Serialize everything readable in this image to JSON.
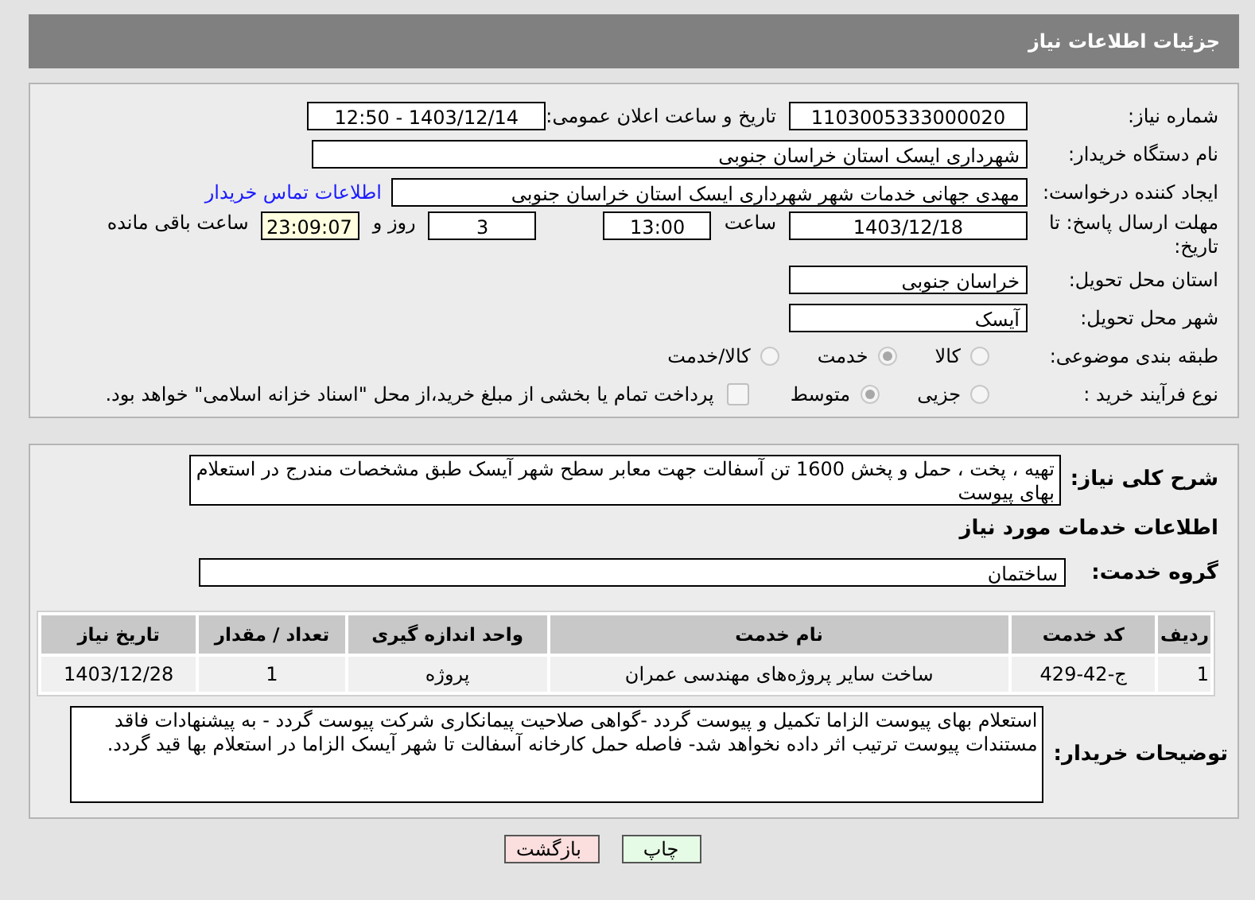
{
  "header": {
    "title": "جزئیات اطلاعات نیاز"
  },
  "need_number": {
    "label": "شماره نیاز:",
    "value": "1103005333000020"
  },
  "announce": {
    "label": "تاریخ و ساعت اعلان عمومی:",
    "value": "1403/12/14 - 12:50"
  },
  "buyer_org": {
    "label": "نام دستگاه خریدار:",
    "value": "شهرداری ایسک استان خراسان جنوبی"
  },
  "requester": {
    "label": "ایجاد کننده درخواست:",
    "value": "مهدی جهانی خدمات شهر شهرداری ایسک استان خراسان جنوبی",
    "link": "اطلاعات تماس خریدار"
  },
  "deadline": {
    "label": "مهلت ارسال پاسخ: تا تاریخ:",
    "date": "1403/12/18",
    "time_label": "ساعت",
    "time": "13:00",
    "days": "3",
    "days_label": "روز و",
    "remaining": "23:09:07",
    "remaining_label": "ساعت باقی مانده"
  },
  "province": {
    "label": "استان محل تحویل:",
    "value": "خراسان جنوبی"
  },
  "city": {
    "label": "شهر محل تحویل:",
    "value": "آیسک"
  },
  "category": {
    "label": "طبقه بندی موضوعی:",
    "options": [
      {
        "label": "کالا",
        "selected": false
      },
      {
        "label": "خدمت",
        "selected": true
      },
      {
        "label": "کالا/خدمت",
        "selected": false
      }
    ]
  },
  "process": {
    "label": "نوع فرآیند خرید :",
    "options": [
      {
        "label": "جزیی",
        "selected": false
      },
      {
        "label": "متوسط",
        "selected": true
      }
    ],
    "checkbox": {
      "checked": false,
      "label": "پرداخت تمام یا بخشی از مبلغ خرید،از محل \"اسناد خزانه اسلامی\" خواهد بود."
    }
  },
  "description": {
    "label": "شرح کلی نیاز:",
    "value": "تهیه ، پخت ، حمل و پخش 1600 تن آسفالت جهت معابر سطح شهر آیسک طبق مشخصات مندرج در استعلام بهای پیوست"
  },
  "services_title": "اطلاعات خدمات مورد نیاز",
  "service_group": {
    "label": "گروه خدمت:",
    "value": "ساختمان"
  },
  "table": {
    "columns": [
      "ردیف",
      "کد خدمت",
      "نام خدمت",
      "واحد اندازه گیری",
      "تعداد / مقدار",
      "تاریخ نیاز"
    ],
    "rows": [
      [
        "1",
        "ج-42-429",
        "ساخت سایر پروژه‌های مهندسی عمران",
        "پروژه",
        "1",
        "1403/12/28"
      ]
    ]
  },
  "buyer_notes": {
    "label": "توضیحات خریدار:",
    "value": "استعلام بهای پیوست الزاما تکمیل و پیوست گردد -گواهی صلاحیت پیمانکاری شرکت پیوست گردد - به پیشنهادات فاقد مستندات پیوست ترتیب اثر داده نخواهد شد- فاصله حمل کارخانه آسفالت تا شهر آیسک الزاما در استعلام بها قید گردد."
  },
  "buttons": [
    {
      "label": "چاپ",
      "kind": "print"
    },
    {
      "label": "بازگشت",
      "kind": "back"
    }
  ]
}
